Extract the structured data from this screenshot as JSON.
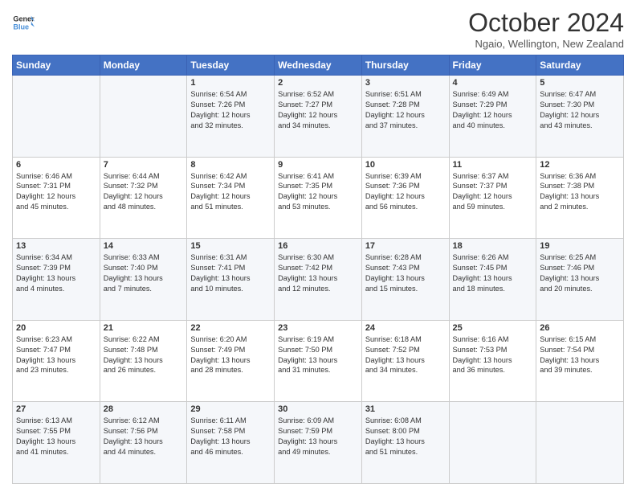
{
  "header": {
    "logo_line1": "General",
    "logo_line2": "Blue",
    "month_title": "October 2024",
    "location": "Ngaio, Wellington, New Zealand"
  },
  "days_of_week": [
    "Sunday",
    "Monday",
    "Tuesday",
    "Wednesday",
    "Thursday",
    "Friday",
    "Saturday"
  ],
  "weeks": [
    [
      {
        "day": "",
        "info": ""
      },
      {
        "day": "",
        "info": ""
      },
      {
        "day": "1",
        "info": "Sunrise: 6:54 AM\nSunset: 7:26 PM\nDaylight: 12 hours\nand 32 minutes."
      },
      {
        "day": "2",
        "info": "Sunrise: 6:52 AM\nSunset: 7:27 PM\nDaylight: 12 hours\nand 34 minutes."
      },
      {
        "day": "3",
        "info": "Sunrise: 6:51 AM\nSunset: 7:28 PM\nDaylight: 12 hours\nand 37 minutes."
      },
      {
        "day": "4",
        "info": "Sunrise: 6:49 AM\nSunset: 7:29 PM\nDaylight: 12 hours\nand 40 minutes."
      },
      {
        "day": "5",
        "info": "Sunrise: 6:47 AM\nSunset: 7:30 PM\nDaylight: 12 hours\nand 43 minutes."
      }
    ],
    [
      {
        "day": "6",
        "info": "Sunrise: 6:46 AM\nSunset: 7:31 PM\nDaylight: 12 hours\nand 45 minutes."
      },
      {
        "day": "7",
        "info": "Sunrise: 6:44 AM\nSunset: 7:32 PM\nDaylight: 12 hours\nand 48 minutes."
      },
      {
        "day": "8",
        "info": "Sunrise: 6:42 AM\nSunset: 7:34 PM\nDaylight: 12 hours\nand 51 minutes."
      },
      {
        "day": "9",
        "info": "Sunrise: 6:41 AM\nSunset: 7:35 PM\nDaylight: 12 hours\nand 53 minutes."
      },
      {
        "day": "10",
        "info": "Sunrise: 6:39 AM\nSunset: 7:36 PM\nDaylight: 12 hours\nand 56 minutes."
      },
      {
        "day": "11",
        "info": "Sunrise: 6:37 AM\nSunset: 7:37 PM\nDaylight: 12 hours\nand 59 minutes."
      },
      {
        "day": "12",
        "info": "Sunrise: 6:36 AM\nSunset: 7:38 PM\nDaylight: 13 hours\nand 2 minutes."
      }
    ],
    [
      {
        "day": "13",
        "info": "Sunrise: 6:34 AM\nSunset: 7:39 PM\nDaylight: 13 hours\nand 4 minutes."
      },
      {
        "day": "14",
        "info": "Sunrise: 6:33 AM\nSunset: 7:40 PM\nDaylight: 13 hours\nand 7 minutes."
      },
      {
        "day": "15",
        "info": "Sunrise: 6:31 AM\nSunset: 7:41 PM\nDaylight: 13 hours\nand 10 minutes."
      },
      {
        "day": "16",
        "info": "Sunrise: 6:30 AM\nSunset: 7:42 PM\nDaylight: 13 hours\nand 12 minutes."
      },
      {
        "day": "17",
        "info": "Sunrise: 6:28 AM\nSunset: 7:43 PM\nDaylight: 13 hours\nand 15 minutes."
      },
      {
        "day": "18",
        "info": "Sunrise: 6:26 AM\nSunset: 7:45 PM\nDaylight: 13 hours\nand 18 minutes."
      },
      {
        "day": "19",
        "info": "Sunrise: 6:25 AM\nSunset: 7:46 PM\nDaylight: 13 hours\nand 20 minutes."
      }
    ],
    [
      {
        "day": "20",
        "info": "Sunrise: 6:23 AM\nSunset: 7:47 PM\nDaylight: 13 hours\nand 23 minutes."
      },
      {
        "day": "21",
        "info": "Sunrise: 6:22 AM\nSunset: 7:48 PM\nDaylight: 13 hours\nand 26 minutes."
      },
      {
        "day": "22",
        "info": "Sunrise: 6:20 AM\nSunset: 7:49 PM\nDaylight: 13 hours\nand 28 minutes."
      },
      {
        "day": "23",
        "info": "Sunrise: 6:19 AM\nSunset: 7:50 PM\nDaylight: 13 hours\nand 31 minutes."
      },
      {
        "day": "24",
        "info": "Sunrise: 6:18 AM\nSunset: 7:52 PM\nDaylight: 13 hours\nand 34 minutes."
      },
      {
        "day": "25",
        "info": "Sunrise: 6:16 AM\nSunset: 7:53 PM\nDaylight: 13 hours\nand 36 minutes."
      },
      {
        "day": "26",
        "info": "Sunrise: 6:15 AM\nSunset: 7:54 PM\nDaylight: 13 hours\nand 39 minutes."
      }
    ],
    [
      {
        "day": "27",
        "info": "Sunrise: 6:13 AM\nSunset: 7:55 PM\nDaylight: 13 hours\nand 41 minutes."
      },
      {
        "day": "28",
        "info": "Sunrise: 6:12 AM\nSunset: 7:56 PM\nDaylight: 13 hours\nand 44 minutes."
      },
      {
        "day": "29",
        "info": "Sunrise: 6:11 AM\nSunset: 7:58 PM\nDaylight: 13 hours\nand 46 minutes."
      },
      {
        "day": "30",
        "info": "Sunrise: 6:09 AM\nSunset: 7:59 PM\nDaylight: 13 hours\nand 49 minutes."
      },
      {
        "day": "31",
        "info": "Sunrise: 6:08 AM\nSunset: 8:00 PM\nDaylight: 13 hours\nand 51 minutes."
      },
      {
        "day": "",
        "info": ""
      },
      {
        "day": "",
        "info": ""
      }
    ]
  ]
}
